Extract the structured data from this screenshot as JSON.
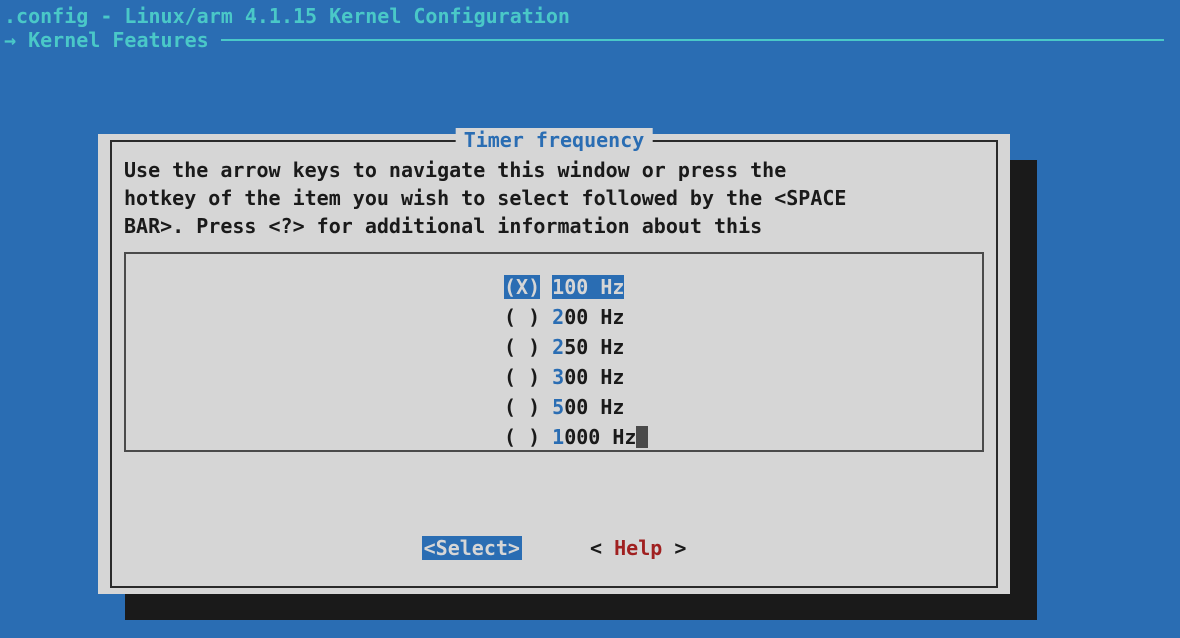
{
  "title": ".config - Linux/arm 4.1.15 Kernel Configuration",
  "breadcrumb_arrow": "→ ",
  "breadcrumb": "Kernel Features",
  "dialog": {
    "title": "Timer frequency",
    "instructions_l1": "Use the arrow keys to navigate this window or press the",
    "instructions_l2": "hotkey of the item you wish to select followed by the <SPACE",
    "instructions_l3": "BAR>. Press <?> for additional information about this"
  },
  "options": [
    {
      "selected": true,
      "hotkey": "1",
      "rest": "00 Hz",
      "highlighted": true
    },
    {
      "selected": false,
      "hotkey": "2",
      "rest": "00 Hz",
      "highlighted": false
    },
    {
      "selected": false,
      "hotkey": "2",
      "rest": "50 Hz",
      "highlighted": false
    },
    {
      "selected": false,
      "hotkey": "3",
      "rest": "00 Hz",
      "highlighted": false
    },
    {
      "selected": false,
      "hotkey": "5",
      "rest": "00 Hz",
      "highlighted": false
    },
    {
      "selected": false,
      "hotkey": "1",
      "rest": "000 Hz",
      "highlighted": false,
      "cursor": true
    }
  ],
  "buttons": {
    "select_open": "<",
    "select_label": "Select",
    "select_close": ">",
    "help_open": "< ",
    "help_label": "Help",
    "help_close": " >"
  }
}
